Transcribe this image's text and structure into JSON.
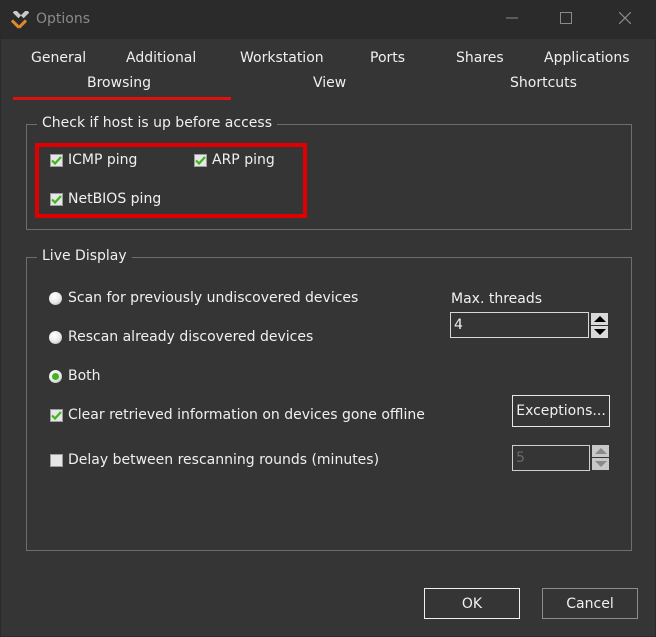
{
  "window": {
    "title": "Options",
    "icon": "tools-icon",
    "controls": {
      "minimize": "minimize-icon",
      "maximize": "maximize-icon",
      "close": "close-icon"
    }
  },
  "tabs": {
    "row1": [
      "General",
      "Additional",
      "Workstation",
      "Ports",
      "Shares",
      "Applications"
    ],
    "row2": [
      "Browsing",
      "View",
      "Shortcuts"
    ],
    "active": "Browsing"
  },
  "host_check": {
    "legend": "Check if host is up before access",
    "options": [
      {
        "label": "ICMP ping",
        "checked": true
      },
      {
        "label": "ARP ping",
        "checked": true
      },
      {
        "label": "NetBIOS ping",
        "checked": true
      }
    ]
  },
  "live_display": {
    "legend": "Live Display",
    "radios": [
      {
        "label": "Scan for previously undiscovered devices",
        "selected": false
      },
      {
        "label": "Rescan already discovered devices",
        "selected": false
      },
      {
        "label": "Both",
        "selected": true
      }
    ],
    "max_threads": {
      "label": "Max. threads",
      "value": "4"
    },
    "clear_offline": {
      "label": "Clear retrieved information on devices gone offline",
      "checked": true
    },
    "exceptions_button": "Exceptions...",
    "delay": {
      "label": "Delay between rescanning rounds (minutes)",
      "checked": false,
      "value": "5",
      "disabled": true
    }
  },
  "footer": {
    "ok": "OK",
    "cancel": "Cancel"
  },
  "colors": {
    "accent_red": "#e00000",
    "check_green": "#3fb51c",
    "background": "#353535"
  }
}
